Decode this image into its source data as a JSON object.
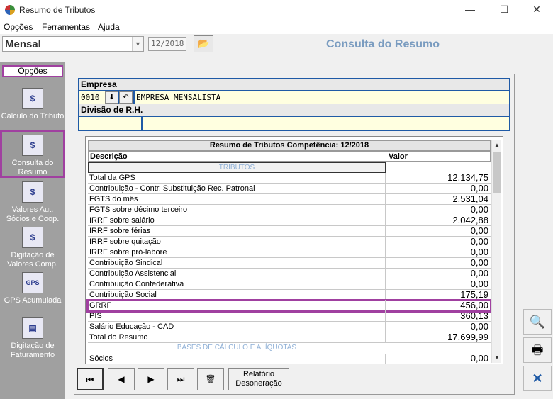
{
  "window": {
    "title": "Resumo de Tributos",
    "minimize": "—",
    "maximize": "☐",
    "close": "✕"
  },
  "menu": {
    "items": [
      "Opções",
      "Ferramentas",
      "Ajuda"
    ]
  },
  "toolbar": {
    "mode_value": "Mensal",
    "period_value": "12/2018",
    "page_title": "Consulta do Resumo"
  },
  "sidebar": {
    "header": "Opções",
    "items": [
      {
        "label": "Cálculo do Tributo",
        "icon": "calculator-icon"
      },
      {
        "label": "Consulta do Resumo",
        "icon": "query-icon"
      },
      {
        "label": "Valores Aut. Sócios e Coop.",
        "icon": "partners-icon"
      },
      {
        "label": "Digitação de Valores Comp.",
        "icon": "entry-icon"
      },
      {
        "label": "GPS Acumulada",
        "icon": "gps-icon"
      },
      {
        "label": "Digitação de Faturamento",
        "icon": "billing-icon"
      }
    ]
  },
  "empresa": {
    "label": "Empresa",
    "code": "0010",
    "name": "EMPRESA MENSALISTA",
    "division_label": "Divisão de R.H."
  },
  "grid": {
    "title": "Resumo de Tributos Competência: 12/2018",
    "col_desc": "Descrição",
    "col_val": "Valor",
    "section1": "TRIBUTOS",
    "rows": [
      {
        "desc": "Total da GPS",
        "value": "12.134,75"
      },
      {
        "desc": "Contribuição - Contr. Substituição Rec. Patronal",
        "value": "0,00"
      },
      {
        "desc": "FGTS do mês",
        "value": "2.531,04"
      },
      {
        "desc": "FGTS sobre décimo terceiro",
        "value": "0,00"
      },
      {
        "desc": "IRRF sobre salário",
        "value": "2.042,88"
      },
      {
        "desc": "IRRF sobre férias",
        "value": "0,00"
      },
      {
        "desc": "IRRF sobre quitação",
        "value": "0,00"
      },
      {
        "desc": "IRRF sobre pró-labore",
        "value": "0,00"
      },
      {
        "desc": "Contribuição Sindical",
        "value": "0,00"
      },
      {
        "desc": "Contribuição Assistencial",
        "value": "0,00"
      },
      {
        "desc": "Contribuição Confederativa",
        "value": "0,00"
      },
      {
        "desc": "Contribuição Social",
        "value": "175,19"
      },
      {
        "desc": "GRRF",
        "value": "456,00"
      },
      {
        "desc": "PIS",
        "value": "360,13"
      },
      {
        "desc": "Salário Educação - CAD",
        "value": "0,00"
      },
      {
        "desc": "Total do Resumo",
        "value": "17.699,99"
      }
    ],
    "section2": "BASES DE CÁLCULO E ALÍQUOTAS",
    "rows2": [
      {
        "desc": "Sócios",
        "value": "0,00"
      }
    ]
  },
  "nav": {
    "first": "⏮",
    "prev": "◀",
    "next": "▶",
    "last": "⏭",
    "delete": "🗑",
    "report": "Relatório Desoneração"
  }
}
